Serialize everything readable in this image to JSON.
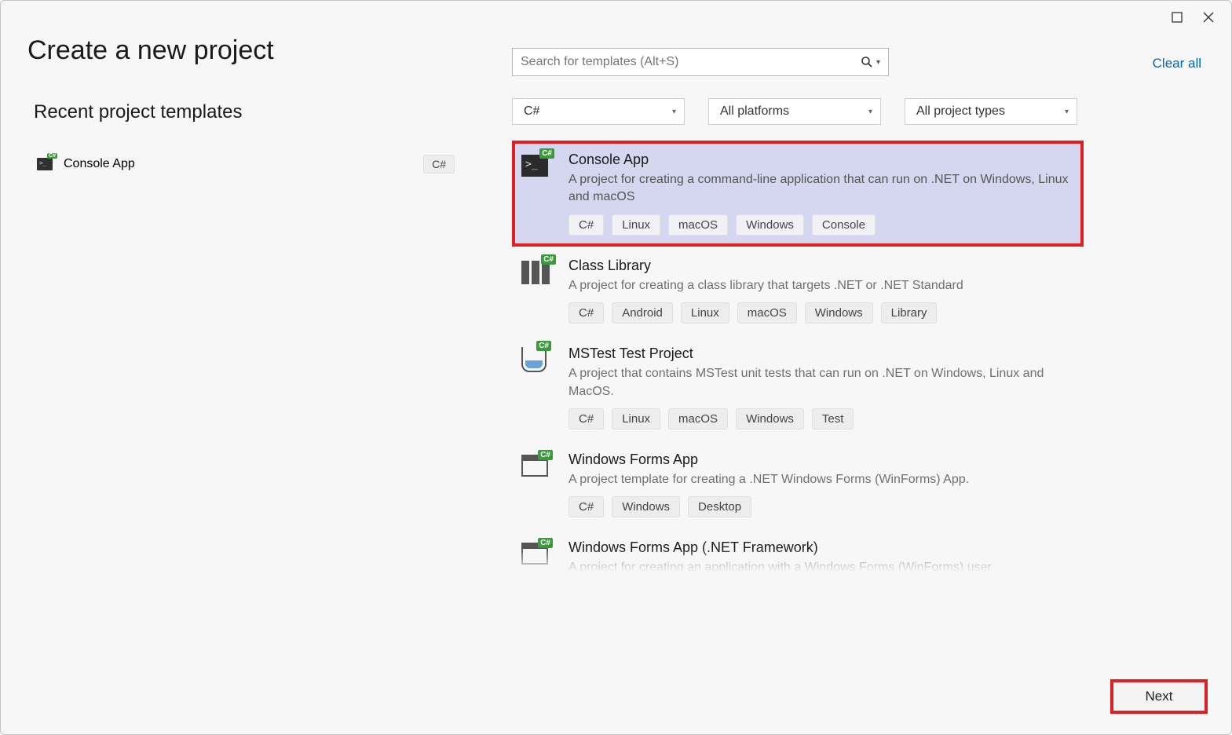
{
  "window": {
    "title": "Create a new project"
  },
  "recent": {
    "heading": "Recent project templates",
    "items": [
      {
        "name": "Console App",
        "language": "C#"
      }
    ]
  },
  "search": {
    "placeholder": "Search for templates (Alt+S)"
  },
  "clear_all_label": "Clear all",
  "filters": {
    "language": "C#",
    "platform": "All platforms",
    "project_type": "All project types"
  },
  "templates": [
    {
      "title": "Console App",
      "description": "A project for creating a command-line application that can run on .NET on Windows, Linux and macOS",
      "tags": [
        "C#",
        "Linux",
        "macOS",
        "Windows",
        "Console"
      ],
      "selected": true,
      "icon": "console"
    },
    {
      "title": "Class Library",
      "description": "A project for creating a class library that targets .NET or .NET Standard",
      "tags": [
        "C#",
        "Android",
        "Linux",
        "macOS",
        "Windows",
        "Library"
      ],
      "selected": false,
      "icon": "library"
    },
    {
      "title": "MSTest Test Project",
      "description": "A project that contains MSTest unit tests that can run on .NET on Windows, Linux and MacOS.",
      "tags": [
        "C#",
        "Linux",
        "macOS",
        "Windows",
        "Test"
      ],
      "selected": false,
      "icon": "test"
    },
    {
      "title": "Windows Forms App",
      "description": "A project template for creating a .NET Windows Forms (WinForms) App.",
      "tags": [
        "C#",
        "Windows",
        "Desktop"
      ],
      "selected": false,
      "icon": "winform"
    },
    {
      "title": "Windows Forms App (.NET Framework)",
      "description": "A project for creating an application with a Windows Forms (WinForms) user",
      "tags": [],
      "selected": false,
      "icon": "winform"
    }
  ],
  "next_button_label": "Next",
  "cs_badge": "C#"
}
